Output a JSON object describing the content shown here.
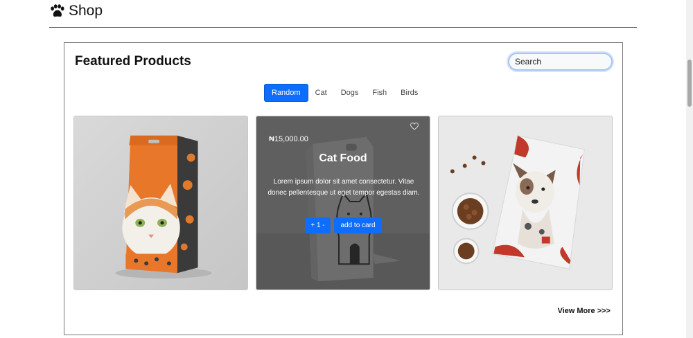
{
  "header": {
    "brand": "Shop",
    "brand_icon": "paw-icon"
  },
  "panel": {
    "title": "Featured Products",
    "search_placeholder": "Search",
    "tabs": [
      {
        "label": "Random",
        "active": true
      },
      {
        "label": "Cat",
        "active": false
      },
      {
        "label": "Dogs",
        "active": false
      },
      {
        "label": "Fish",
        "active": false
      },
      {
        "label": "Birds",
        "active": false
      }
    ],
    "products": [
      {
        "image": "cat-food-bag-image"
      },
      {
        "image": "cat-food-box-image",
        "price": "₦15,000.00",
        "title": "Cat Food",
        "description": "Lorem ipsum dolor sit amet consectetur. Vitae donec pellentesque ut eget tempor egestas diam.",
        "qty_label": "+ 1 -",
        "add_label": "add to card",
        "favorite_icon": "heart-icon"
      },
      {
        "image": "dog-food-pouch-image"
      }
    ],
    "view_more": "View More >>>"
  },
  "colors": {
    "accent": "#0d6efd",
    "card_overlay": "#000000"
  }
}
